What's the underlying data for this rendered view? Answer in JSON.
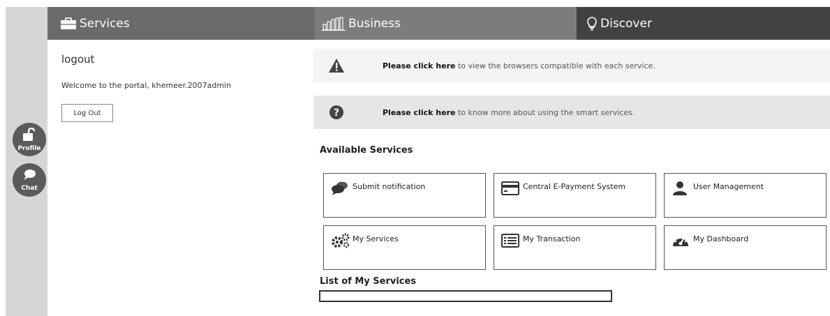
{
  "rail": {
    "profile_label": "Profile",
    "chat_label": "Chat"
  },
  "nav": {
    "services": "Services",
    "business": "Business",
    "discover": "Discover",
    "colors": {
      "services_bg": "#6b6b6b",
      "business_bg": "#7c7c7c",
      "discover_bg": "#424242"
    }
  },
  "account": {
    "title": "logout",
    "welcome": "Welcome to the portal, khemeer.2007admin",
    "logout_button": "Log Out"
  },
  "notices": [
    {
      "icon": "warning-icon",
      "link": "Please click here",
      "text": " to view the browsers compatible with each service."
    },
    {
      "icon": "help-icon",
      "link": "Please click here",
      "text": " to know more about using the smart services."
    }
  ],
  "available_services": {
    "title": "Available Services",
    "cards": [
      {
        "icon": "chat-bubbles-icon",
        "label": "Submit notification"
      },
      {
        "icon": "credit-card-icon",
        "label": "Central E-Payment System"
      },
      {
        "icon": "user-icon",
        "label": "User Management"
      },
      {
        "icon": "gears-icon",
        "label": "My Services"
      },
      {
        "icon": "list-icon",
        "label": "My Transaction"
      },
      {
        "icon": "dashboard-icon",
        "label": "My Dashboard"
      }
    ]
  },
  "my_services": {
    "title": "List of My Services"
  }
}
